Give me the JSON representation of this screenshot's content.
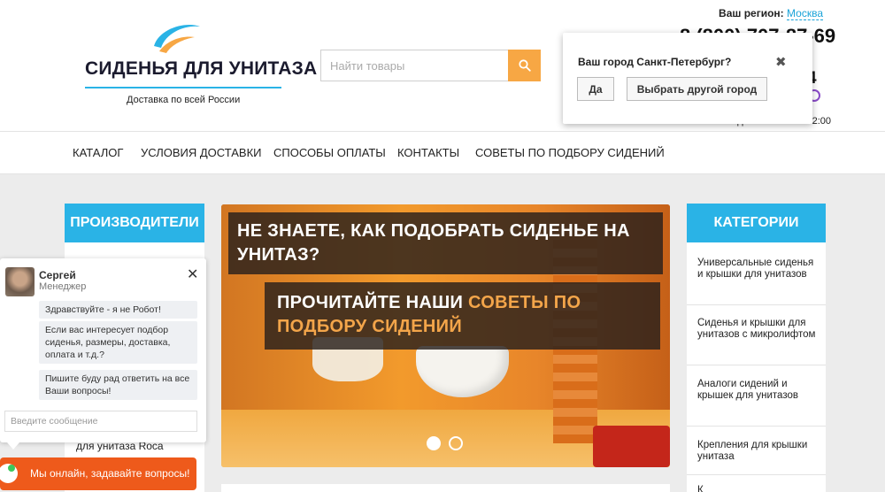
{
  "header": {
    "logo_title": "СИДЕНЬЯ ДЛЯ УНИТАЗА",
    "logo_subtitle": "Доставка по всей России",
    "search_placeholder": "Найти товары",
    "region_label": "Ваш регион:",
    "region_city": "Москва",
    "phone_partial": "8 (800) 707-87-69",
    "phone2_partial": "4",
    "phone_label_partial": "ий",
    "hours_partial": "ежедневно 9:00 — 22:00"
  },
  "city_popup": {
    "question": "Ваш город Санкт-Петербург?",
    "yes_label": "Да",
    "other_label": "Выбрать другой город",
    "close_glyph": "✖"
  },
  "nav": {
    "items": [
      "КАТАЛОГ",
      "УСЛОВИЯ ДОСТАВКИ",
      "СПОСОБЫ ОПЛАТЫ",
      "КОНТАКТЫ",
      "СОВЕТЫ ПО ПОДБОРУ СИДЕНИЙ"
    ]
  },
  "left_panel": {
    "title": "ПРОИЗВОДИТЕЛИ",
    "partial_item": "для унитаза Roca"
  },
  "banner": {
    "line1": "НЕ ЗНАЕТЕ, КАК ПОДОБРАТЬ СИДЕНЬЕ НА УНИТАЗ?",
    "line2_prefix": "ПРОЧИТАЙТЕ НАШИ ",
    "line2_highlight": "СОВЕТЫ ПО ПОДБОРУ СИДЕНИЙ",
    "slides_total": 2,
    "active_slide": 1
  },
  "right_panel": {
    "title": "КАТЕГОРИИ",
    "items": [
      "Универсальные сиденья и крышки для унитазов",
      "Сиденья и крышки для унитазов с микролифтом",
      "Аналоги сидений и крышек для унитазов",
      "Крепления для крышки унитаза",
      "К"
    ]
  },
  "chat": {
    "agent_name": "Сергей",
    "agent_role": "Менеджер",
    "messages": [
      "Здравствуйте - я не Робот!",
      "Если вас интересует подбор сиденья, размеры, доставка, оплата и т.д.?",
      "Пишите буду рад ответить на все Ваши вопросы!"
    ],
    "input_placeholder": "Введите сообщение",
    "online_label": "Мы онлайн, задавайте вопросы!"
  },
  "colors": {
    "accent_blue": "#2ab3e6",
    "search_orange": "#f7a744",
    "chat_orange": "#ee5a1b",
    "banner_highlight": "#f3a54a"
  }
}
